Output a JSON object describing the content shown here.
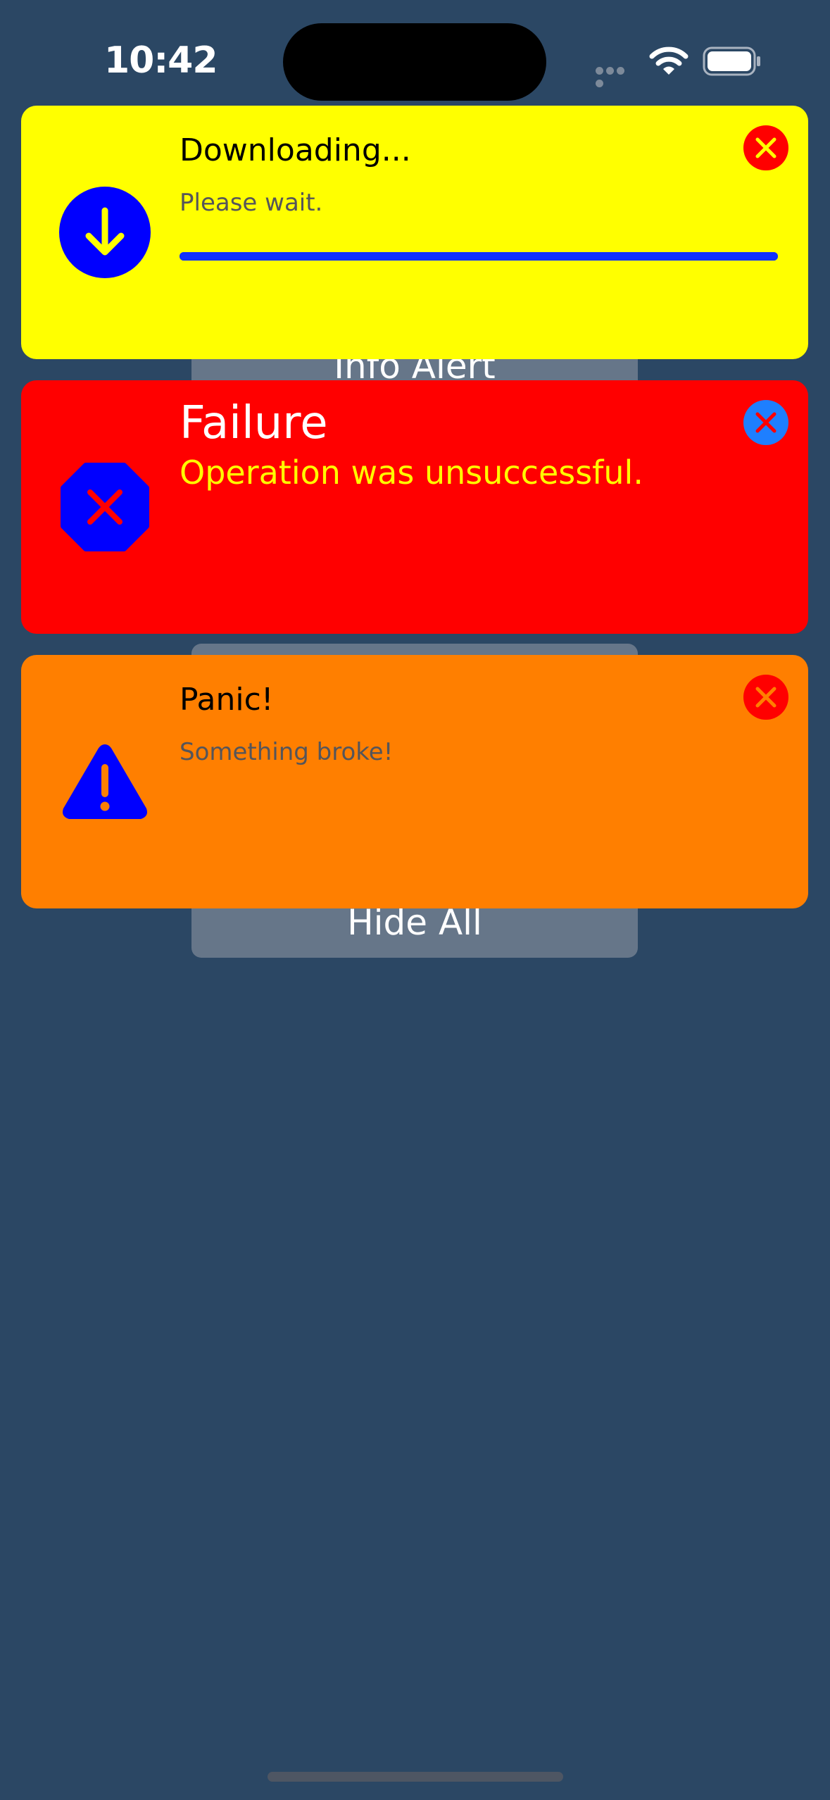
{
  "status_bar": {
    "time": "10:42",
    "icons": [
      "cellular-signal-icon",
      "wifi-icon",
      "battery-icon"
    ]
  },
  "background_buttons": {
    "info_alert_label": "Info Alert",
    "hide_all_label": "Hide All"
  },
  "alerts": [
    {
      "title": "Downloading...",
      "message": "Please wait.",
      "icon": "download-arrow-icon",
      "background_color": "#ffff00",
      "close_color": "#ff0000",
      "progress": 1.0
    },
    {
      "title": "Failure",
      "message": "Operation was unsuccessful.",
      "icon": "octagon-x-icon",
      "background_color": "#ff0000",
      "close_color": "#1e7fff"
    },
    {
      "title": "Panic!",
      "message": "Something broke!",
      "icon": "warning-triangle-icon",
      "background_color": "#ff7f00",
      "close_color": "#ff0000"
    }
  ]
}
